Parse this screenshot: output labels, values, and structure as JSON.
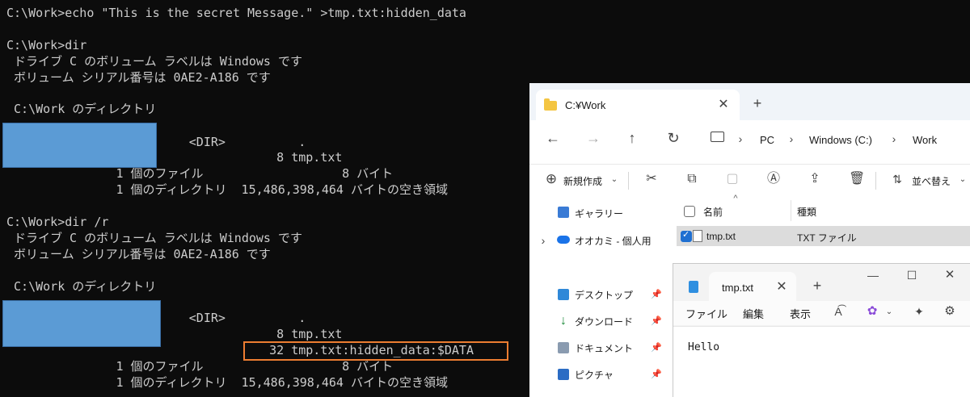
{
  "console": {
    "lines": [
      "C:\\Work>echo \"This is the secret Message.\" >tmp.txt:hidden_data",
      "",
      "C:\\Work>dir",
      " ドライブ C のボリューム ラベルは Windows です",
      " ボリューム シリアル番号は 0AE2-A186 です",
      "",
      " C:\\Work のディレクトリ",
      "",
      "                         <DIR>          .",
      "                                     8 tmp.txt",
      "               1 個のファイル                   8 バイト",
      "               1 個のディレクトリ  15,486,398,464 バイトの空き領域",
      "",
      "C:\\Work>dir /r",
      " ドライブ C のボリューム ラベルは Windows です",
      " ボリューム シリアル番号は 0AE2-A186 です",
      "",
      " C:\\Work のディレクトリ",
      "",
      "                         <DIR>          .",
      "                                     8 tmp.txt",
      "                                    32 tmp.txt:hidden_data:$DATA",
      "               1 個のファイル                   8 バイト",
      "               1 個のディレクトリ  15,486,398,464 バイトの空き領域"
    ]
  },
  "explorer": {
    "tab_title": "C:¥Work",
    "nav": {
      "crumbs": [
        "PC",
        "Windows (C:)",
        "Work"
      ]
    },
    "toolbar": {
      "new_label": "新規作成",
      "sort_label": "並べ替え"
    },
    "sidebar": {
      "gallery": "ギャラリー",
      "onedrive": "オオカミ - 個人用",
      "desktop": "デスクトップ",
      "downloads": "ダウンロード",
      "documents": "ドキュメント",
      "pictures": "ピクチャ"
    },
    "columns": {
      "name": "名前",
      "type": "種類"
    },
    "file": {
      "name": "tmp.txt",
      "type": "TXT ファイル"
    }
  },
  "notepad": {
    "tab_title": "tmp.txt",
    "menu": {
      "file": "ファイル",
      "edit": "編集",
      "view": "表示"
    },
    "content": "Hello"
  },
  "colors": {
    "redaction": "#5b9bd5",
    "highlight": "#ed7d31",
    "accent": "#1f6fd1"
  }
}
